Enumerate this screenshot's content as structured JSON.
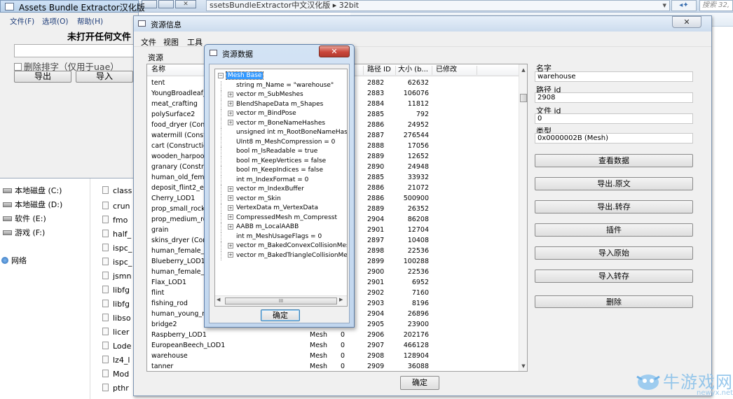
{
  "bg_window": {
    "title": "Assets Bundle Extractor汉化版",
    "menu": [
      "文件(F)",
      "选项(O)",
      "帮助(H)"
    ],
    "heading": "未打开任何文件",
    "checkbox_label": "删除排字（仅用于uae）",
    "export_label": "导出",
    "import_label": "导入"
  },
  "explorer": {
    "address": "ssetsBundleExtractor中文汉化版",
    "address_folder": "32bit",
    "search_placeholder": "搜索 32,",
    "drives": [
      "本地磁盘 (C:)",
      "本地磁盘 (D:)",
      "软件 (E:)",
      "游戏 (F:)"
    ],
    "network": "网络",
    "files": [
      "class",
      "crun",
      "fmo",
      "half_",
      "ispc_",
      "ispc_",
      "jsmn",
      "libfg",
      "libfg",
      "libso",
      "licer",
      "Lode",
      "lz4_l",
      "Mod",
      "pthr"
    ]
  },
  "asset_window": {
    "title": "资源信息",
    "menu": [
      "文件",
      "视图",
      "工具"
    ],
    "section_label": "资源",
    "columns": [
      "名称",
      "",
      "",
      "路径 ID",
      "大小 (b...",
      "已修改"
    ],
    "rows": [
      {
        "name": "tent",
        "type": "",
        "file": "",
        "path_id": "2882",
        "size": "62632"
      },
      {
        "name": "YoungBroadleaf_L",
        "type": "",
        "file": "",
        "path_id": "2883",
        "size": "106076"
      },
      {
        "name": "meat_crafting",
        "type": "",
        "file": "",
        "path_id": "2884",
        "size": "11812"
      },
      {
        "name": "polySurface2",
        "type": "",
        "file": "",
        "path_id": "2885",
        "size": "792"
      },
      {
        "name": "food_dryer (Const",
        "type": "",
        "file": "",
        "path_id": "2886",
        "size": "24952"
      },
      {
        "name": "watermill (Constru",
        "type": "",
        "file": "",
        "path_id": "2887",
        "size": "276544"
      },
      {
        "name": "cart (Construction",
        "type": "",
        "file": "",
        "path_id": "2888",
        "size": "17056"
      },
      {
        "name": "wooden_harpoon",
        "type": "",
        "file": "",
        "path_id": "2889",
        "size": "12652"
      },
      {
        "name": "granary (Construc",
        "type": "",
        "file": "",
        "path_id": "2890",
        "size": "24948"
      },
      {
        "name": "human_old_femal",
        "type": "",
        "file": "",
        "path_id": "2885",
        "size": "33932"
      },
      {
        "name": "deposit_flint2_ext",
        "type": "",
        "file": "",
        "path_id": "2886",
        "size": "21072"
      },
      {
        "name": "Cherry_LOD1",
        "type": "",
        "file": "",
        "path_id": "2886",
        "size": "500900"
      },
      {
        "name": "prop_small_rocks",
        "type": "",
        "file": "",
        "path_id": "2889",
        "size": "26352"
      },
      {
        "name": "prop_medium_roc",
        "type": "",
        "file": "",
        "path_id": "2904",
        "size": "86208"
      },
      {
        "name": "grain",
        "type": "",
        "file": "",
        "path_id": "2901",
        "size": "12704"
      },
      {
        "name": "skins_dryer (Cons",
        "type": "",
        "file": "",
        "path_id": "2897",
        "size": "10408"
      },
      {
        "name": "human_female_st",
        "type": "",
        "file": "",
        "path_id": "2898",
        "size": "22536"
      },
      {
        "name": "Blueberry_LOD1",
        "type": "",
        "file": "",
        "path_id": "2899",
        "size": "100288"
      },
      {
        "name": "human_female_st",
        "type": "",
        "file": "",
        "path_id": "2900",
        "size": "22536"
      },
      {
        "name": "Flax_LOD1",
        "type": "",
        "file": "",
        "path_id": "2901",
        "size": "6952"
      },
      {
        "name": "flint",
        "type": "",
        "file": "",
        "path_id": "2902",
        "size": "7160"
      },
      {
        "name": "fishing_rod",
        "type": "",
        "file": "",
        "path_id": "2903",
        "size": "8196"
      },
      {
        "name": "human_young_ma",
        "type": "",
        "file": "",
        "path_id": "2904",
        "size": "26896"
      },
      {
        "name": "bridge2",
        "type": "",
        "file": "",
        "path_id": "2905",
        "size": "23900"
      },
      {
        "name": "Raspberry_LOD1",
        "type": "Mesh",
        "file": "0",
        "path_id": "2906",
        "size": "202176"
      },
      {
        "name": "EuropeanBeech_LOD1",
        "type": "Mesh",
        "file": "0",
        "path_id": "2907",
        "size": "466128"
      },
      {
        "name": "warehouse",
        "type": "Mesh",
        "file": "0",
        "path_id": "2908",
        "size": "128904"
      },
      {
        "name": "tanner",
        "type": "Mesh",
        "file": "0",
        "path_id": "2909",
        "size": "36088"
      }
    ],
    "fields": {
      "name_label": "名字",
      "name_value": "warehouse",
      "path_label": "路径 id",
      "path_value": "2908",
      "file_label": "文件 id",
      "file_value": "0",
      "type_label": "类型",
      "type_value": "0x0000002B (Mesh)"
    },
    "buttons": [
      "查看数据",
      "导出.原文",
      "导出.转存",
      "插件",
      "导入原始",
      "导入转存",
      "删除"
    ],
    "ok_label": "确定"
  },
  "data_dialog": {
    "title": "资源数据",
    "close_glyph": "✕",
    "tree": [
      {
        "text": "Mesh Base",
        "expander": "−",
        "indent": 0,
        "selected": true
      },
      {
        "text": "string m_Name = \"warehouse\"",
        "expander": "",
        "indent": 1
      },
      {
        "text": "vector m_SubMeshes",
        "expander": "+",
        "indent": 1
      },
      {
        "text": "BlendShapeData m_Shapes",
        "expander": "+",
        "indent": 1
      },
      {
        "text": "vector m_BindPose",
        "expander": "+",
        "indent": 1
      },
      {
        "text": "vector m_BoneNameHashes",
        "expander": "+",
        "indent": 1
      },
      {
        "text": "unsigned int m_RootBoneNameHash",
        "expander": "",
        "indent": 1
      },
      {
        "text": "UInt8 m_MeshCompression = 0",
        "expander": "",
        "indent": 1
      },
      {
        "text": "bool m_IsReadable = true",
        "expander": "",
        "indent": 1
      },
      {
        "text": "bool m_KeepVertices = false",
        "expander": "",
        "indent": 1
      },
      {
        "text": "bool m_KeepIndices = false",
        "expander": "",
        "indent": 1
      },
      {
        "text": "int m_IndexFormat = 0",
        "expander": "",
        "indent": 1
      },
      {
        "text": "vector m_IndexBuffer",
        "expander": "+",
        "indent": 1
      },
      {
        "text": "vector m_Skin",
        "expander": "+",
        "indent": 1
      },
      {
        "text": "VertexData m_VertexData",
        "expander": "+",
        "indent": 1
      },
      {
        "text": "CompressedMesh m_Compresst",
        "expander": "+",
        "indent": 1
      },
      {
        "text": "AABB m_LocalAABB",
        "expander": "+",
        "indent": 1
      },
      {
        "text": "int m_MeshUsageFlags = 0",
        "expander": "",
        "indent": 1
      },
      {
        "text": "vector m_BakedConvexCollisionMesh",
        "expander": "+",
        "indent": 1
      },
      {
        "text": "vector m_BakedTriangleCollisionMes",
        "expander": "+",
        "indent": 1
      }
    ],
    "scroll_mid": "III",
    "ok_label": "确定"
  },
  "watermark": {
    "brand": "牛游戏网",
    "url": "newyx.net"
  },
  "colors": {
    "selection": "#3399ff",
    "title_gradient": "#c7dcf3",
    "close_red": "#c9473b"
  }
}
